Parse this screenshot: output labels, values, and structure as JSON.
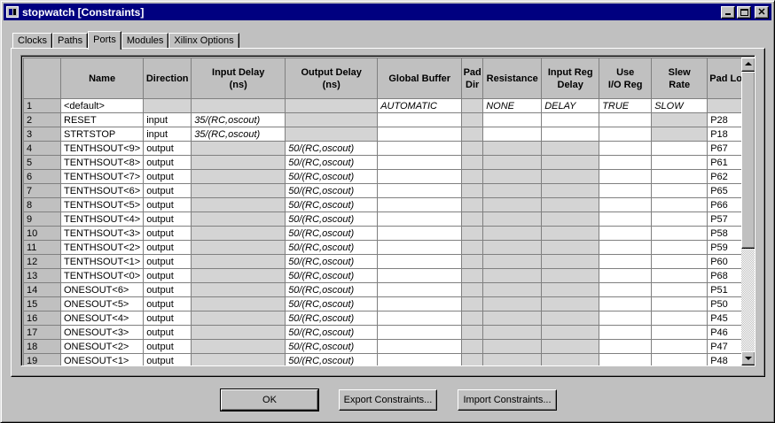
{
  "window": {
    "title": "stopwatch [Constraints]"
  },
  "tabs": [
    {
      "label": "Clocks",
      "active": false
    },
    {
      "label": "Paths",
      "active": false
    },
    {
      "label": "Ports",
      "active": true
    },
    {
      "label": "Modules",
      "active": false
    },
    {
      "label": "Xilinx Options",
      "active": false
    }
  ],
  "columns": [
    {
      "l1": "Name",
      "l2": ""
    },
    {
      "l1": "Direction",
      "l2": ""
    },
    {
      "l1": "Input Delay",
      "l2": "(ns)"
    },
    {
      "l1": "Output Delay",
      "l2": "(ns)"
    },
    {
      "l1": "Global Buffer",
      "l2": ""
    },
    {
      "l1": "Pad",
      "l2": "Dir"
    },
    {
      "l1": "Resistance",
      "l2": ""
    },
    {
      "l1": "Input Reg",
      "l2": "Delay"
    },
    {
      "l1": "Use",
      "l2": "I/O Reg"
    },
    {
      "l1": "Slew",
      "l2": "Rate"
    },
    {
      "l1": "Pad Loc",
      "l2": ""
    }
  ],
  "rows": [
    {
      "num": "1",
      "name": "<default>",
      "direction": "",
      "input_delay": "",
      "output_delay": "",
      "global_buffer": "AUTOMATIC",
      "pad_dir": "",
      "resistance": "NONE",
      "input_reg_delay": "DELAY",
      "use_io_reg": "TRUE",
      "slew_rate": "SLOW",
      "pad_loc": ""
    },
    {
      "num": "2",
      "name": "RESET",
      "direction": "input",
      "input_delay": "35/(RC,oscout)",
      "output_delay": "",
      "global_buffer": "",
      "pad_dir": "",
      "resistance": "",
      "input_reg_delay": "",
      "use_io_reg": "",
      "slew_rate": "",
      "pad_loc": "P28"
    },
    {
      "num": "3",
      "name": "STRTSTOP",
      "direction": "input",
      "input_delay": "35/(RC,oscout)",
      "output_delay": "",
      "global_buffer": "",
      "pad_dir": "",
      "resistance": "",
      "input_reg_delay": "",
      "use_io_reg": "",
      "slew_rate": "",
      "pad_loc": "P18"
    },
    {
      "num": "4",
      "name": "TENTHSOUT<9>",
      "direction": "output",
      "input_delay": "",
      "output_delay": "50/(RC,oscout)",
      "global_buffer": "",
      "pad_dir": "",
      "resistance": "",
      "input_reg_delay": "",
      "use_io_reg": "",
      "slew_rate": "",
      "pad_loc": "P67"
    },
    {
      "num": "5",
      "name": "TENTHSOUT<8>",
      "direction": "output",
      "input_delay": "",
      "output_delay": "50/(RC,oscout)",
      "global_buffer": "",
      "pad_dir": "",
      "resistance": "",
      "input_reg_delay": "",
      "use_io_reg": "",
      "slew_rate": "",
      "pad_loc": "P61"
    },
    {
      "num": "6",
      "name": "TENTHSOUT<7>",
      "direction": "output",
      "input_delay": "",
      "output_delay": "50/(RC,oscout)",
      "global_buffer": "",
      "pad_dir": "",
      "resistance": "",
      "input_reg_delay": "",
      "use_io_reg": "",
      "slew_rate": "",
      "pad_loc": "P62"
    },
    {
      "num": "7",
      "name": "TENTHSOUT<6>",
      "direction": "output",
      "input_delay": "",
      "output_delay": "50/(RC,oscout)",
      "global_buffer": "",
      "pad_dir": "",
      "resistance": "",
      "input_reg_delay": "",
      "use_io_reg": "",
      "slew_rate": "",
      "pad_loc": "P65"
    },
    {
      "num": "8",
      "name": "TENTHSOUT<5>",
      "direction": "output",
      "input_delay": "",
      "output_delay": "50/(RC,oscout)",
      "global_buffer": "",
      "pad_dir": "",
      "resistance": "",
      "input_reg_delay": "",
      "use_io_reg": "",
      "slew_rate": "",
      "pad_loc": "P66"
    },
    {
      "num": "9",
      "name": "TENTHSOUT<4>",
      "direction": "output",
      "input_delay": "",
      "output_delay": "50/(RC,oscout)",
      "global_buffer": "",
      "pad_dir": "",
      "resistance": "",
      "input_reg_delay": "",
      "use_io_reg": "",
      "slew_rate": "",
      "pad_loc": "P57"
    },
    {
      "num": "10",
      "name": "TENTHSOUT<3>",
      "direction": "output",
      "input_delay": "",
      "output_delay": "50/(RC,oscout)",
      "global_buffer": "",
      "pad_dir": "",
      "resistance": "",
      "input_reg_delay": "",
      "use_io_reg": "",
      "slew_rate": "",
      "pad_loc": "P58"
    },
    {
      "num": "11",
      "name": "TENTHSOUT<2>",
      "direction": "output",
      "input_delay": "",
      "output_delay": "50/(RC,oscout)",
      "global_buffer": "",
      "pad_dir": "",
      "resistance": "",
      "input_reg_delay": "",
      "use_io_reg": "",
      "slew_rate": "",
      "pad_loc": "P59"
    },
    {
      "num": "12",
      "name": "TENTHSOUT<1>",
      "direction": "output",
      "input_delay": "",
      "output_delay": "50/(RC,oscout)",
      "global_buffer": "",
      "pad_dir": "",
      "resistance": "",
      "input_reg_delay": "",
      "use_io_reg": "",
      "slew_rate": "",
      "pad_loc": "P60"
    },
    {
      "num": "13",
      "name": "TENTHSOUT<0>",
      "direction": "output",
      "input_delay": "",
      "output_delay": "50/(RC,oscout)",
      "global_buffer": "",
      "pad_dir": "",
      "resistance": "",
      "input_reg_delay": "",
      "use_io_reg": "",
      "slew_rate": "",
      "pad_loc": "P68"
    },
    {
      "num": "14",
      "name": "ONESOUT<6>",
      "direction": "output",
      "input_delay": "",
      "output_delay": "50/(RC,oscout)",
      "global_buffer": "",
      "pad_dir": "",
      "resistance": "",
      "input_reg_delay": "",
      "use_io_reg": "",
      "slew_rate": "",
      "pad_loc": "P51"
    },
    {
      "num": "15",
      "name": "ONESOUT<5>",
      "direction": "output",
      "input_delay": "",
      "output_delay": "50/(RC,oscout)",
      "global_buffer": "",
      "pad_dir": "",
      "resistance": "",
      "input_reg_delay": "",
      "use_io_reg": "",
      "slew_rate": "",
      "pad_loc": "P50"
    },
    {
      "num": "16",
      "name": "ONESOUT<4>",
      "direction": "output",
      "input_delay": "",
      "output_delay": "50/(RC,oscout)",
      "global_buffer": "",
      "pad_dir": "",
      "resistance": "",
      "input_reg_delay": "",
      "use_io_reg": "",
      "slew_rate": "",
      "pad_loc": "P45"
    },
    {
      "num": "17",
      "name": "ONESOUT<3>",
      "direction": "output",
      "input_delay": "",
      "output_delay": "50/(RC,oscout)",
      "global_buffer": "",
      "pad_dir": "",
      "resistance": "",
      "input_reg_delay": "",
      "use_io_reg": "",
      "slew_rate": "",
      "pad_loc": "P46"
    },
    {
      "num": "18",
      "name": "ONESOUT<2>",
      "direction": "output",
      "input_delay": "",
      "output_delay": "50/(RC,oscout)",
      "global_buffer": "",
      "pad_dir": "",
      "resistance": "",
      "input_reg_delay": "",
      "use_io_reg": "",
      "slew_rate": "",
      "pad_loc": "P47"
    },
    {
      "num": "19",
      "name": "ONESOUT<1>",
      "direction": "output",
      "input_delay": "",
      "output_delay": "50/(RC,oscout)",
      "global_buffer": "",
      "pad_dir": "",
      "resistance": "",
      "input_reg_delay": "",
      "use_io_reg": "",
      "slew_rate": "",
      "pad_loc": "P48"
    }
  ],
  "buttons": {
    "ok": "OK",
    "export": "Export Constraints...",
    "import": "Import Constraints..."
  },
  "colors": {
    "titlebar": "#000080",
    "face": "#c0c0c0",
    "cell": "#ffffff"
  }
}
